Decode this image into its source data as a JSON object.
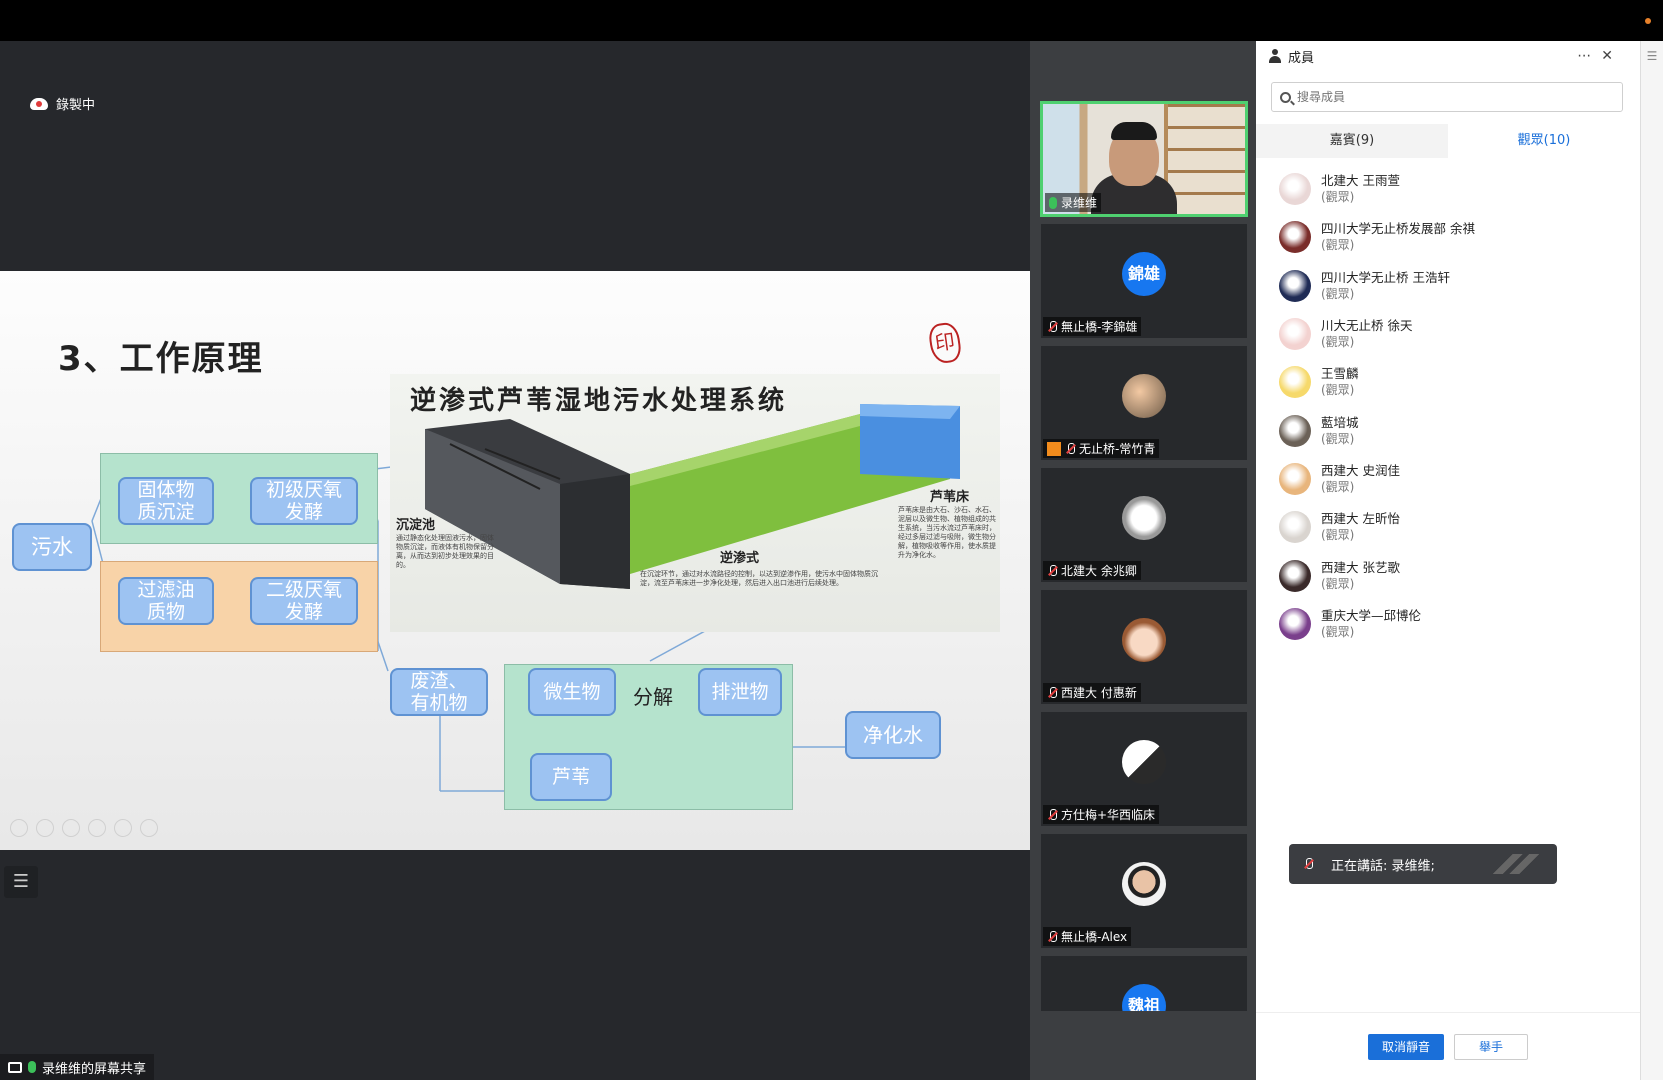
{
  "recording": {
    "label": "錄製中"
  },
  "slide": {
    "title": "3、工作原理",
    "diagram_title": "逆渗式芦苇湿地污水处理系统",
    "diagram_labels": {
      "settling": "沉淀池",
      "reverse": "逆渗式",
      "reed_bed": "芦苇床"
    },
    "diagram_texts": {
      "settling": "通过静态化处理固液污水，固体物质沉淀，而液体有机物保留分离，从而达到初步处理效果的目的。",
      "reverse": "在沉淀环节，通过对水流路径的控制，以达到逆渗作用，使污水中固体物质沉淀，流至芦苇床进一步净化处理，然后进入出口池进行后续处理。",
      "reed_bed": "芦苇床是由大石、沙石、水石、泥层以及微生物、植物组成的共生系统，当污水流过芦苇床时，经过多层过滤与吸附，微生物分解，植物吸收等作用，使水质提升为净化水。"
    },
    "nodes": {
      "sewage": "污水",
      "solid": "固体物质沉淀",
      "primary": "初级厌氧发酵",
      "oil": "过滤油质物",
      "secondary": "二级厌氧发酵",
      "waste": "废渣、有机物",
      "microbe": "微生物",
      "decompose": "分解",
      "excreta": "排泄物",
      "reed": "芦苇",
      "clean": "净化水"
    }
  },
  "share_bar": {
    "label": "录维维的屏幕共享"
  },
  "video_tiles": [
    {
      "name": "录维维",
      "avatar_text": "",
      "active": true
    },
    {
      "name": "無止橋-李錦雄",
      "avatar_text": "錦雄",
      "active": false
    },
    {
      "name": "无止桥-常竹青",
      "avatar_text": "",
      "active": false
    },
    {
      "name": "北建大 余兆卿",
      "avatar_text": "",
      "active": false
    },
    {
      "name": "西建大 付惠新",
      "avatar_text": "",
      "active": false
    },
    {
      "name": "方仕梅+华西临床",
      "avatar_text": "",
      "active": false
    },
    {
      "name": "無止橋-Alex",
      "avatar_text": "",
      "active": false
    },
    {
      "name": "",
      "avatar_text": "魏祖",
      "active": false
    }
  ],
  "panel": {
    "title": "成員",
    "more_icon": "⋯",
    "close_icon": "✕",
    "side_icon": "☰",
    "search_placeholder": "搜尋成員",
    "tab_guests": "嘉賓(9)",
    "tab_audience": "觀眾(10)",
    "members": [
      {
        "name": "北建大 王雨萱",
        "role": "(觀眾)",
        "color": "#e9d7d6"
      },
      {
        "name": "四川大学无止桥发展部 余祺",
        "role": "(觀眾)",
        "color": "#7a2d2a"
      },
      {
        "name": "四川大学无止桥 王浩轩",
        "role": "(觀眾)",
        "color": "#1f2b55"
      },
      {
        "name": "川大无止桥 徐天",
        "role": "(觀眾)",
        "color": "#f3d2d0"
      },
      {
        "name": "王雪麟",
        "role": "(觀眾)",
        "color": "#f6d96b"
      },
      {
        "name": "藍培城",
        "role": "(觀眾)",
        "color": "#6b6157"
      },
      {
        "name": "西建大 史润佳",
        "role": "(觀眾)",
        "color": "#e8b57c"
      },
      {
        "name": "西建大 左昕怡",
        "role": "(觀眾)",
        "color": "#d9d4cf"
      },
      {
        "name": "西建大 张艺歌",
        "role": "(觀眾)",
        "color": "#3a2a2a"
      },
      {
        "name": "重庆大学—邱博伦",
        "role": "(觀眾)",
        "color": "#7a3f8c"
      }
    ],
    "speaking_toast": "正在講話: 录维维;",
    "unmute_button": "取消靜音",
    "raise_hand_button": "舉手"
  },
  "colors": {
    "accent": "#1a6fd9",
    "active_speaker": "#4fd070",
    "box_fill": "#9dc3f2",
    "group_green": "#b5e3cd",
    "group_orange": "#f8d3a8"
  }
}
